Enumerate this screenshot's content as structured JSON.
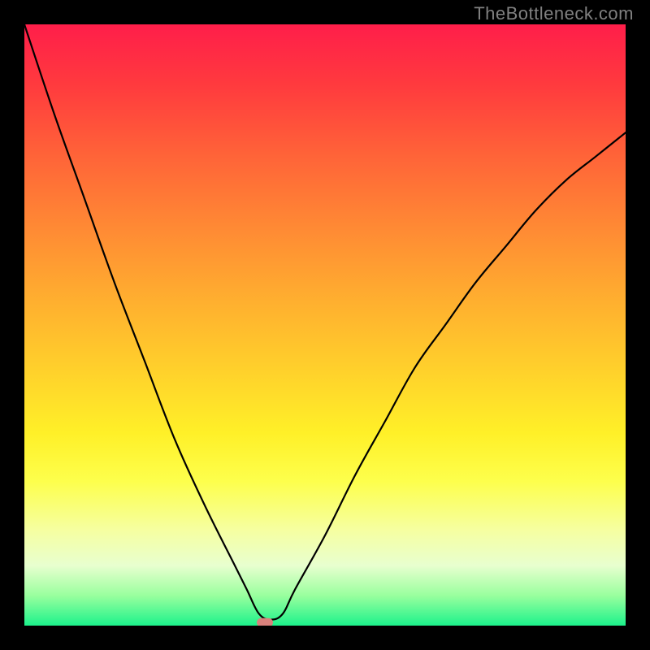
{
  "watermark": {
    "text": "TheBottleneck.com"
  },
  "chart_data": {
    "type": "line",
    "title": "",
    "xlabel": "",
    "ylabel": "",
    "xlim": [
      0,
      100
    ],
    "ylim": [
      0,
      100
    ],
    "background_gradient": {
      "direction": "vertical",
      "stops": [
        {
          "pos": 0.0,
          "color": "#ff1e4a"
        },
        {
          "pos": 0.22,
          "color": "#ff6438"
        },
        {
          "pos": 0.46,
          "color": "#ffaf2f"
        },
        {
          "pos": 0.68,
          "color": "#fff028"
        },
        {
          "pos": 0.84,
          "color": "#f6ffa0"
        },
        {
          "pos": 1.0,
          "color": "#1cf28b"
        }
      ]
    },
    "series": [
      {
        "name": "bottleneck-curve",
        "x": [
          0,
          5,
          10,
          15,
          20,
          25,
          30,
          35,
          37,
          39,
          41,
          43,
          45,
          50,
          55,
          60,
          65,
          70,
          75,
          80,
          85,
          90,
          95,
          100
        ],
        "values": [
          100,
          85,
          71,
          57,
          44,
          31,
          20,
          10,
          6,
          2,
          1,
          2,
          6,
          15,
          25,
          34,
          43,
          50,
          57,
          63,
          69,
          74,
          78,
          82
        ]
      }
    ],
    "marker": {
      "x": 40,
      "y": 0.5,
      "color": "#d9817c",
      "size": 20
    },
    "annotations": []
  }
}
